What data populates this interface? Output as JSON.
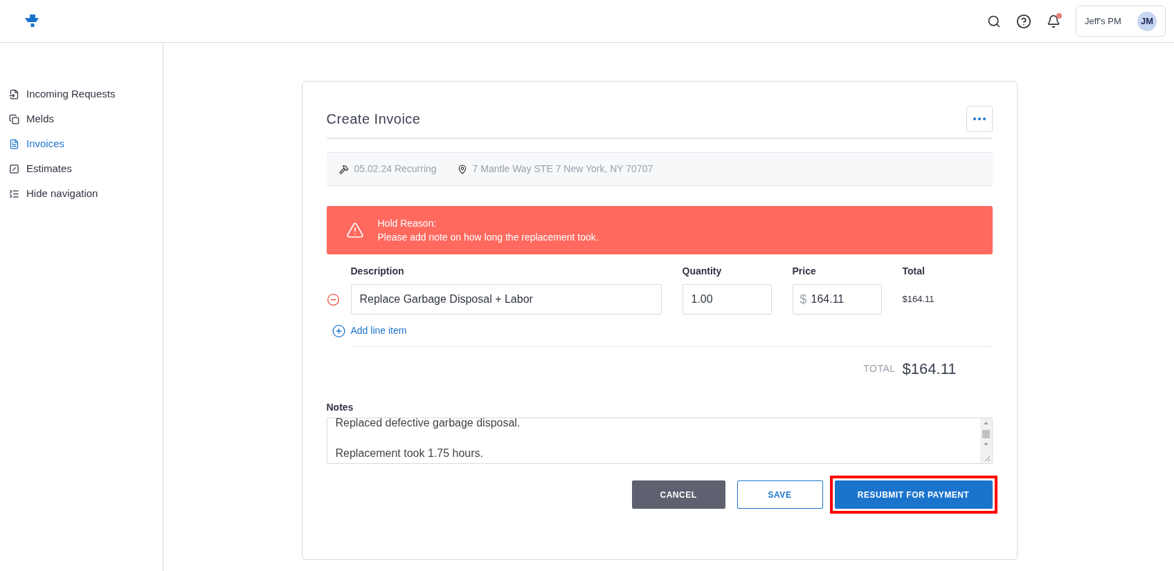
{
  "header": {
    "user_name": "Jeff's PM",
    "avatar_initials": "JM",
    "notifications_unread": true
  },
  "sidebar": {
    "items": [
      {
        "label": "Incoming Requests",
        "selected": false
      },
      {
        "label": "Melds",
        "selected": false
      },
      {
        "label": "Invoices",
        "selected": true
      },
      {
        "label": "Estimates",
        "selected": false
      },
      {
        "label": "Hide navigation",
        "selected": false
      }
    ]
  },
  "invoice": {
    "title": "Create Invoice",
    "meld": "05.02.24 Recurring",
    "address": "7 Mantle Way STE 7 New York, NY 70707",
    "hold": {
      "title": "Hold Reason:",
      "message": "Please add note on how long the replacement took."
    },
    "columns": [
      "Description",
      "Quantity",
      "Price",
      "Total"
    ],
    "line_items": [
      {
        "description": "Replace Garbage Disposal + Labor",
        "quantity": "1.00",
        "currency": "$",
        "price": "164.11",
        "total": "$164.11"
      }
    ],
    "add_line_item": "Add line item",
    "total_label": "TOTAL",
    "total": "$164.11",
    "notes_label": "Notes",
    "notes": "Replaced defective garbage disposal.\n\nReplacement took 1.75 hours.",
    "buttons": [
      {
        "label": "CANCEL",
        "kind": "secondary",
        "highlighted": false
      },
      {
        "label": "SAVE",
        "kind": "outline",
        "highlighted": false
      },
      {
        "label": "RESUBMIT FOR PAYMENT",
        "kind": "primary",
        "highlighted": true
      }
    ]
  }
}
